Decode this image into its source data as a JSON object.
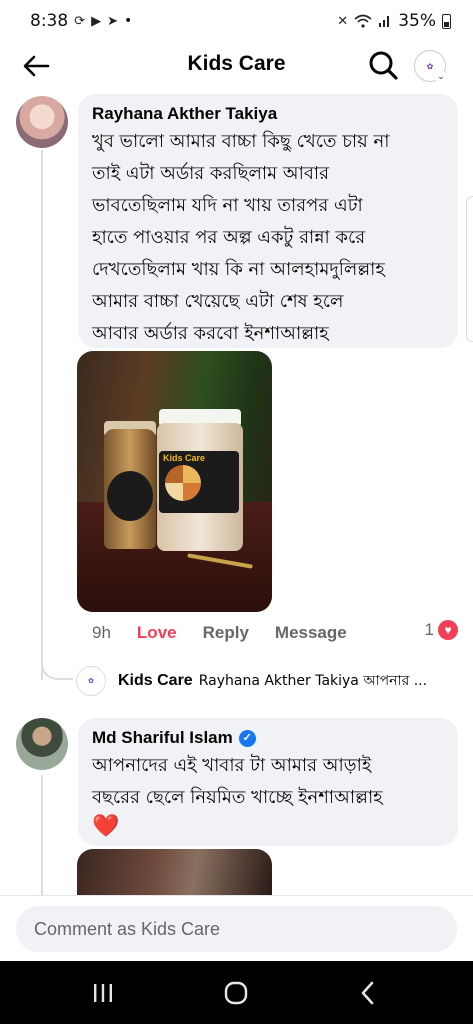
{
  "status_bar": {
    "time": "8:38",
    "battery": "35%"
  },
  "header": {
    "title": "Kids Care"
  },
  "comments": [
    {
      "author": "Rayhana Akther Takiya",
      "text": "খুব ভালো আমার বাচ্চা কিছু খেতে চায় না\nতাই এটা অর্ডার করছিলাম আবার\nভাবতেছিলাম যদি না খায় তারপর এটা\nহাতে পাওয়ার পর অল্প একটু রান্না করে\nদেখতেছিলাম খায় কি না আলহামদুলিল্লাহ\nআমার বাচ্চা খেয়েছে এটা শেষ হলে\nআবার অর্ডার করবো ইনশাআল্লাহ",
      "photo_brand": "Kids Care",
      "actions": {
        "time": "9h",
        "love": "Love",
        "reply": "Reply",
        "message": "Message",
        "reaction_count": "1"
      },
      "reply_preview": {
        "author": "Kids Care",
        "snippet": "Rayhana Akther Takiya আপনার ..."
      }
    },
    {
      "author": "Md Shariful Islam",
      "verified": true,
      "text": "আপনাদের এই খাবার টা আমার আড়াই\nবছরের ছেলে নিয়মিত খাচ্ছে ইনশাআল্লাহ",
      "emoji": "❤️"
    }
  ],
  "composer": {
    "placeholder": "Comment as Kids Care"
  },
  "nav": {
    "recents_icon": "recents-icon",
    "home_icon": "home-icon",
    "back_icon": "back-icon"
  }
}
